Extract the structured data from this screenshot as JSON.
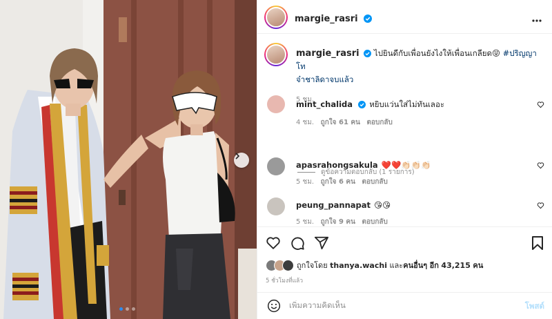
{
  "post": {
    "author": "margie_rasri",
    "verified": true,
    "more_icon": "more-horizontal-icon",
    "caption": {
      "username": "margie_rasri",
      "text": "ไปยินดีกับเพื่อนยังไงให้เพื่อนเกลียด😝",
      "hashtag_part1": "#ปริญญาโท",
      "hashtag_part2": "จ๋าชาลิดาจบแล้ว",
      "time": "5 ชม."
    }
  },
  "comments": [
    {
      "username": "mint_chalida",
      "verified": true,
      "text": "หยิบแว่นใส่ไม่ทันเลอะ",
      "time": "4 ชม.",
      "likes": "ถูกใจ 61 คน",
      "reply": "ตอบกลับ",
      "avatar_color": "#e8b8b0"
    },
    {
      "username": "apasrahongsakula",
      "verified": false,
      "text": "❤️❤️👏🏻👏🏻👏🏻",
      "time": "5 ชม.",
      "likes": "ถูกใจ 6 คน",
      "reply": "ตอบกลับ",
      "avatar_color": "#9a9a9a"
    },
    {
      "username": "peung_pannapat",
      "verified": false,
      "text": "😘😘",
      "time": "5 ชม.",
      "likes": "ถูกใจ 9 คน",
      "reply": "ตอบกลับ",
      "avatar_color": "#c9c4be"
    }
  ],
  "view_replies": "ดูข้อความตอบกลับ (1 รายการ)",
  "actions": {
    "like_icon": "heart-icon",
    "comment_icon": "comment-icon",
    "share_icon": "send-icon",
    "save_icon": "bookmark-icon"
  },
  "likes_summary": {
    "prefix": "ถูกใจโดย",
    "user": "thanya.wachi",
    "middle": "และ",
    "others": "คนอื่นๆ",
    "suffix": "อีก",
    "count": "43,215",
    "unit": "คน"
  },
  "posted_ago": "5 ชั่วโมงที่แล้ว",
  "add_comment": {
    "placeholder": "เพิ่มความคิดเห็น",
    "post_label": "โพสต์",
    "emoji_icon": "emoji-icon"
  },
  "carousel": {
    "dots": 3,
    "active_index": 0,
    "next_icon": "chevron-right-icon"
  },
  "colors": {
    "accent": "#0095f6",
    "muted": "#8e8e8e",
    "link": "#00376b",
    "heart_red": "#ed4956"
  }
}
